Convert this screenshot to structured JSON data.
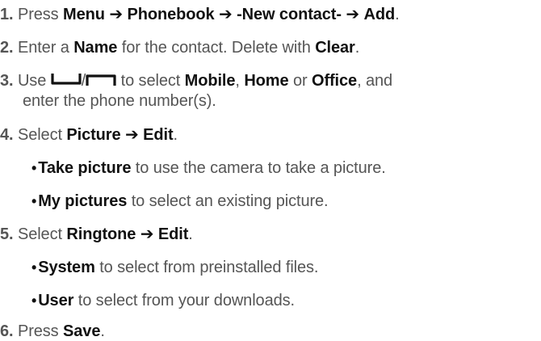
{
  "steps": [
    {
      "num": "1.",
      "parts": {
        "p0": "Press ",
        "b0": "Menu",
        "p1": " ",
        "b1": "Phonebook",
        "p2": " ",
        "b2": "-New contact-",
        "p3": " ",
        "b3": "Add",
        "p4": "."
      }
    },
    {
      "num": "2.",
      "parts": {
        "p0": "Enter a ",
        "b0": "Name",
        "p1": " for the contact. Delete with ",
        "b1": "Clear",
        "p2": "."
      }
    },
    {
      "num": "3.",
      "parts": {
        "p0": "Use ",
        "slash": "/",
        "p1": " to select ",
        "b0": "Mobile",
        "p2": ", ",
        "b1": "Home",
        "p3": " or ",
        "b2": "Office",
        "p4": ", and",
        "cont": "enter the phone number(s)."
      }
    },
    {
      "num": "4.",
      "parts": {
        "p0": "Select ",
        "b0": "Picture",
        "p1": " ",
        "b1": "Edit",
        "p2": "."
      },
      "bullets": [
        {
          "b": "Take picture",
          "t": " to use the camera to take a picture."
        },
        {
          "b": "My pictures",
          "t": " to select an existing picture."
        }
      ]
    },
    {
      "num": "5.",
      "parts": {
        "p0": "Select ",
        "b0": "Ringtone",
        "p1": " ",
        "b1": "Edit",
        "p2": "."
      },
      "bullets": [
        {
          "b": "System",
          "t": " to select from preinstalled files."
        },
        {
          "b": "User",
          "t": " to select from your downloads."
        }
      ]
    },
    {
      "num": "6.",
      "parts": {
        "p0": "Press ",
        "b0": "Save",
        "p1": "."
      }
    }
  ],
  "symbols": {
    "arrow": "➔",
    "bullet": "•"
  },
  "icons": {
    "left_softkey": "left-softkey-icon",
    "right_softkey": "right-softkey-icon"
  },
  "colors": {
    "text": "#555555",
    "emphasis": "#111111"
  }
}
